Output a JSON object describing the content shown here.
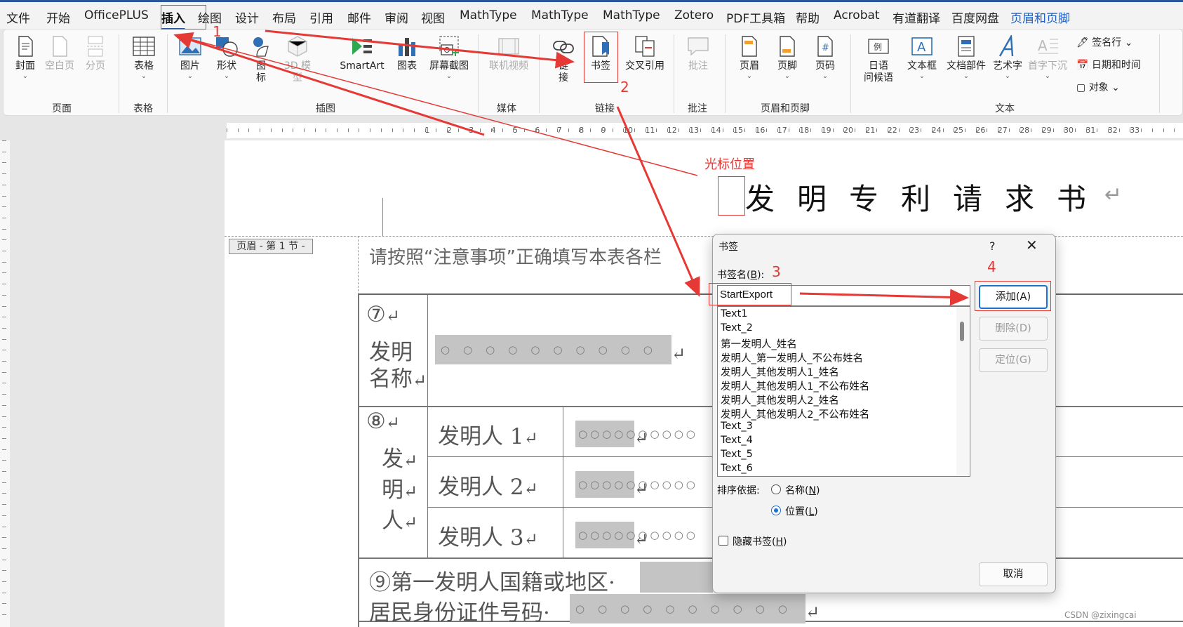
{
  "tabs": [
    "文件",
    "开始",
    "OfficePLUS",
    "插入",
    "绘图",
    "设计",
    "布局",
    "引用",
    "邮件",
    "审阅",
    "视图",
    "MathType",
    "MathType",
    "MathType",
    "Zotero",
    "PDF工具箱",
    "帮助",
    "Acrobat",
    "有道翻译",
    "百度网盘",
    "页眉和页脚"
  ],
  "ribbon": {
    "cover": "封面",
    "blank_page": "空白页",
    "page_break": "分页",
    "table": "表格",
    "picture": "图片",
    "shapes": "形状",
    "icons_l1": "图",
    "icons_l2": "标",
    "model3d_l1": "3D 模",
    "model3d_l2": "型",
    "smartart": "SmartArt",
    "chart": "图表",
    "screenshot": "屏幕截图",
    "online_video": "联机视频",
    "link_l1": "链",
    "link_l2": "接",
    "bookmark": "书签",
    "cross_ref": "交叉引用",
    "comment": "批注",
    "header": "页眉",
    "footer": "页脚",
    "page_number": "页码",
    "date_greeting_l1": "日语",
    "date_greeting_l2": "问候语",
    "textbox": "文本框",
    "quick_parts": "文档部件",
    "wordart": "艺术字",
    "drop_cap": "首字下沉",
    "signature_line": "签名行",
    "date_time": "日期和时间",
    "object": "对象",
    "groups": {
      "pages": "页面",
      "tables": "表格",
      "illustrations": "插图",
      "media": "媒体",
      "links": "链接",
      "comments": "批注",
      "header_footer": "页眉和页脚",
      "text": "文本"
    }
  },
  "ruler_numbers": [
    "1",
    "2",
    "3",
    "4",
    "5",
    "6",
    "7",
    "8",
    "9",
    "10",
    "11",
    "12",
    "13",
    "14",
    "15",
    "16",
    "17",
    "18",
    "19",
    "20",
    "21",
    "22",
    "23",
    "24",
    "25",
    "26",
    "27",
    "28",
    "29",
    "30",
    "31",
    "32",
    "33"
  ],
  "document": {
    "cursor_caption": "光标位置",
    "title": "发明专利请求书",
    "header_label": "页眉 - 第 1 节 -",
    "notice": "请按照“注意事项”正确填写本表各栏",
    "row7_num": "⑦",
    "row7_label_l1": "发明",
    "row7_label_l2": "名称",
    "row8_num": "⑧",
    "row8_label_1": "发",
    "row8_label_2": "明",
    "row8_label_3": "人",
    "inventor1": "发明人 1",
    "inventor2": "发明人 2",
    "inventor3": "发明人 3",
    "row9_line1": "⑨第一发明人国籍或地区·",
    "row9_line2": "居民身份证件号码·",
    "return_mark": "↵",
    "field_dots": "○○○○○○○○○○"
  },
  "dialog": {
    "title": "书签",
    "help": "?",
    "close": "✕",
    "name_label_prefix": "书签名(",
    "name_label_key": "B",
    "name_label_suffix": "):",
    "name_value": "StartExport",
    "bookmarks": [
      "Text1",
      "Text_2",
      "第一发明人_姓名",
      "发明人_第一发明人_不公布姓名",
      "发明人_其他发明人1_姓名",
      "发明人_其他发明人1_不公布姓名",
      "发明人_其他发明人2_姓名",
      "发明人_其他发明人2_不公布姓名",
      "Text_3",
      "Text_4",
      "Text_5",
      "Text_6"
    ],
    "sort_label": "排序依据:",
    "sort_name_prefix": "名称(",
    "sort_name_key": "N",
    "sort_name_suffix": ")",
    "sort_position_prefix": "位置(",
    "sort_position_key": "L",
    "sort_position_suffix": ")",
    "sort_selected": "position",
    "hidden_prefix": "隐藏书签(",
    "hidden_key": "H",
    "hidden_suffix": ")",
    "hidden_checked": false,
    "add_button": "添加(A)",
    "delete_button": "删除(D)",
    "goto_button": "定位(G)",
    "cancel_button": "取消"
  },
  "annotations": {
    "step1": "1",
    "step2": "2",
    "step3": "3",
    "step4": "4",
    "color": "#e53935"
  },
  "watermark": "CSDN @zixingcai",
  "colors": {
    "accent": "#2b579a",
    "context_tab": "#1f5fbf",
    "primary_button": "#1f6fd0",
    "annotation": "#e53935"
  }
}
